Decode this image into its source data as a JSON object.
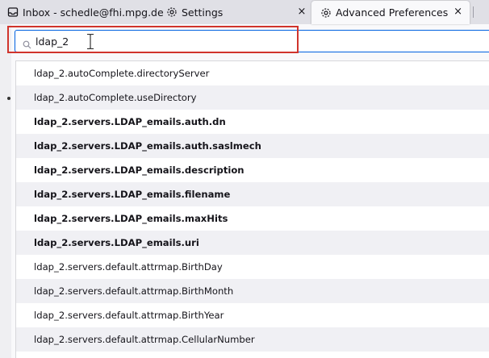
{
  "tabs": [
    {
      "label": "Inbox - schedle@fhi.mpg.de",
      "icon": "inbox-icon"
    },
    {
      "label": "Settings",
      "icon": "gear-icon"
    },
    {
      "label": "Advanced Preferences",
      "icon": "gear-icon",
      "active": true
    }
  ],
  "close_glyph": "×",
  "search": {
    "value": "ldap_2",
    "icon": "search-icon"
  },
  "prefs": [
    {
      "name": "ldap_2.autoComplete.directoryServer",
      "modified": false
    },
    {
      "name": "ldap_2.autoComplete.useDirectory",
      "modified": false
    },
    {
      "name": "ldap_2.servers.LDAP_emails.auth.dn",
      "modified": true
    },
    {
      "name": "ldap_2.servers.LDAP_emails.auth.saslmech",
      "modified": true
    },
    {
      "name": "ldap_2.servers.LDAP_emails.description",
      "modified": true
    },
    {
      "name": "ldap_2.servers.LDAP_emails.filename",
      "modified": true
    },
    {
      "name": "ldap_2.servers.LDAP_emails.maxHits",
      "modified": true
    },
    {
      "name": "ldap_2.servers.LDAP_emails.uri",
      "modified": true
    },
    {
      "name": "ldap_2.servers.default.attrmap.BirthDay",
      "modified": false
    },
    {
      "name": "ldap_2.servers.default.attrmap.BirthMonth",
      "modified": false
    },
    {
      "name": "ldap_2.servers.default.attrmap.BirthYear",
      "modified": false
    },
    {
      "name": "ldap_2.servers.default.attrmap.CellularNumber",
      "modified": false
    },
    {
      "name": "",
      "modified": false
    }
  ],
  "colors": {
    "highlight": "#d0342c",
    "focus": "#0061e0"
  }
}
